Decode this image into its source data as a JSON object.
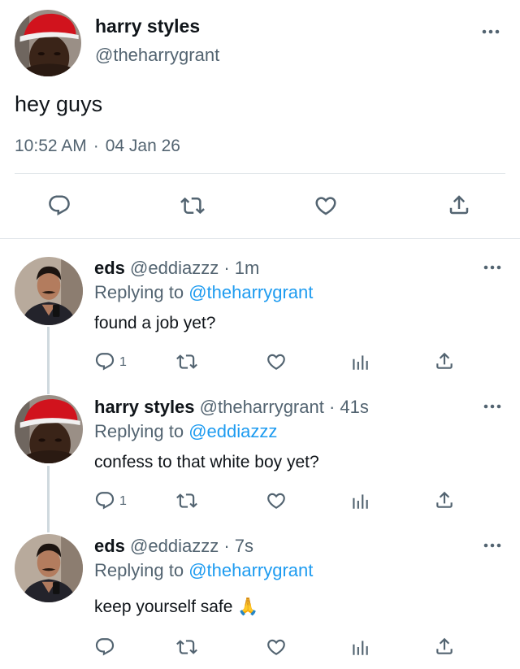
{
  "main_tweet": {
    "author_name": "harry styles",
    "author_handle": "@theharrygrant",
    "text": "hey guys",
    "time": "10:52 AM",
    "separator": "·",
    "date": "04 Jan 26",
    "avatar_icon": "avatar-red-cap",
    "more_icon": "more-options-icon",
    "actions": [
      "reply-icon",
      "retweet-icon",
      "like-icon",
      "share-icon"
    ]
  },
  "replies": [
    {
      "author_name": "eds",
      "meta": "@eddiazzz · 1m",
      "replying_prefix": "Replying to",
      "replying_to": "@theharrygrant",
      "text": "found a job yet?",
      "reply_count": "1"
    },
    {
      "author_name": "harry styles",
      "meta": "@theharrygrant · 41s",
      "replying_prefix": "Replying to",
      "replying_to": "@eddiazzz",
      "text": "confess to that white boy yet?",
      "reply_count": "1"
    },
    {
      "author_name": "eds",
      "meta": "@eddiazzz · 7s",
      "replying_prefix": "Replying to",
      "replying_to": "@theharrygrant",
      "text": "keep yourself safe 🙏",
      "reply_count": ""
    }
  ],
  "colors": {
    "text": "#0f1419",
    "secondary": "#536471",
    "link": "#1d9bf0",
    "divider": "#e1e6ea",
    "icon": "#536471"
  }
}
